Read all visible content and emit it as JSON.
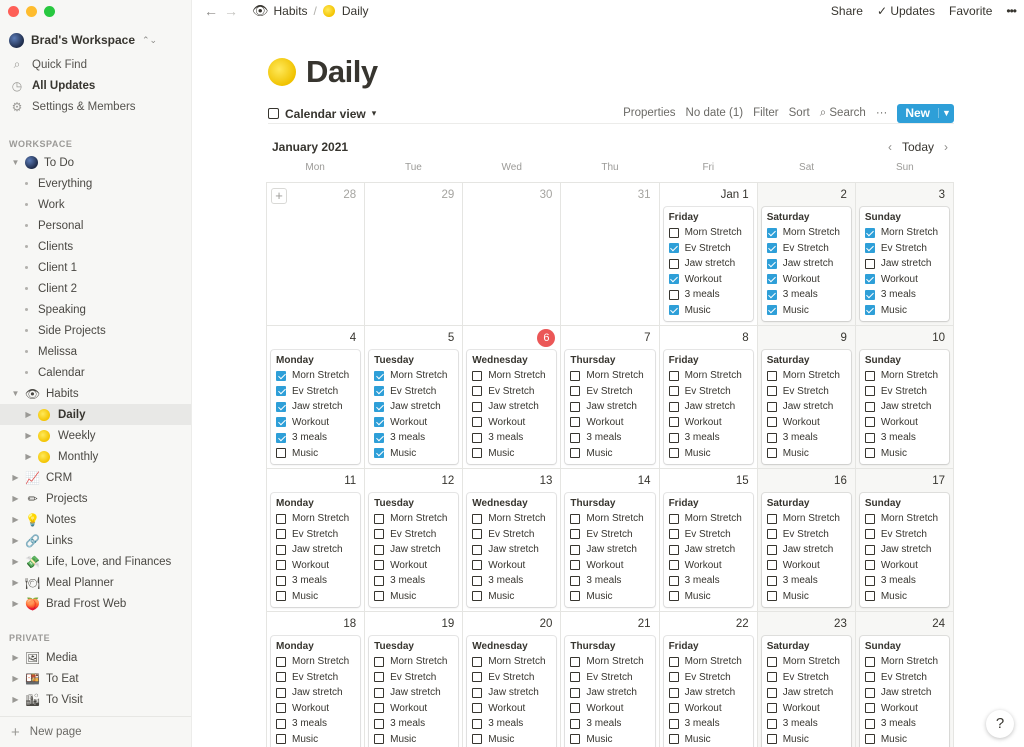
{
  "sidebar": {
    "workspace": "Brad's Workspace",
    "top_items": [
      {
        "label": "Quick Find",
        "icon": "search-icon"
      },
      {
        "label": "All Updates",
        "icon": "clock-icon",
        "bold": true
      },
      {
        "label": "Settings & Members",
        "icon": "gear-icon"
      }
    ],
    "workspace_label": "WORKSPACE",
    "private_label": "PRIVATE",
    "tree": [
      {
        "label": "To Do",
        "level": 0,
        "kind": "globe",
        "expanded": true
      },
      {
        "label": "Everything",
        "level": 1,
        "kind": "bullet"
      },
      {
        "label": "Work",
        "level": 1,
        "kind": "bullet"
      },
      {
        "label": "Personal",
        "level": 1,
        "kind": "bullet"
      },
      {
        "label": "Clients",
        "level": 1,
        "kind": "bullet"
      },
      {
        "label": "Client 1",
        "level": 1,
        "kind": "bullet"
      },
      {
        "label": "Client 2",
        "level": 1,
        "kind": "bullet"
      },
      {
        "label": "Speaking",
        "level": 1,
        "kind": "bullet"
      },
      {
        "label": "Side Projects",
        "level": 1,
        "kind": "bullet"
      },
      {
        "label": "Melissa",
        "level": 1,
        "kind": "bullet"
      },
      {
        "label": "Calendar",
        "level": 1,
        "kind": "bullet"
      },
      {
        "label": "Habits",
        "level": 0,
        "kind": "eye",
        "expanded": true
      },
      {
        "label": "Daily",
        "level": 1,
        "kind": "sun",
        "active": true
      },
      {
        "label": "Weekly",
        "level": 1,
        "kind": "sun"
      },
      {
        "label": "Monthly",
        "level": 1,
        "kind": "sun"
      },
      {
        "label": "CRM",
        "level": 0,
        "kind": "chart"
      },
      {
        "label": "Projects",
        "level": 0,
        "kind": "pencil"
      },
      {
        "label": "Notes",
        "level": 0,
        "kind": "bulb"
      },
      {
        "label": "Links",
        "level": 0,
        "kind": "link"
      },
      {
        "label": "Life, Love, and Finances",
        "level": 0,
        "kind": "money"
      },
      {
        "label": "Meal Planner",
        "level": 0,
        "kind": "dish"
      },
      {
        "label": "Brad Frost Web",
        "level": 0,
        "kind": "peach"
      }
    ],
    "private_tree": [
      {
        "label": "Media",
        "kind": "frame"
      },
      {
        "label": "To Eat",
        "kind": "food"
      },
      {
        "label": "To Visit",
        "kind": "city"
      }
    ],
    "new_page": "New page"
  },
  "topbar": {
    "crumb1": "Habits",
    "crumb2": "Daily",
    "share": "Share",
    "updates": "Updates",
    "favorite": "Favorite",
    "more": "•••"
  },
  "page": {
    "title": "Daily",
    "view": "Calendar view",
    "actions": [
      "Properties",
      "No date (1)",
      "Filter",
      "Sort",
      "Search"
    ],
    "new": "New",
    "month": "January 2021",
    "today": "Today"
  },
  "weekdays": [
    "Mon",
    "Tue",
    "Wed",
    "Thu",
    "Fri",
    "Sat",
    "Sun"
  ],
  "habits": [
    "Morn Stretch",
    "Ev Stretch",
    "Jaw stretch",
    "Workout",
    "3 meals",
    "Music"
  ],
  "habits_alt": [
    "Morn Stretch",
    "Ev Stretch",
    "Jaw stretch",
    "Workout",
    "3 meals",
    "Music"
  ],
  "days": [
    {
      "num": "28",
      "muted": true
    },
    {
      "num": "29",
      "muted": true
    },
    {
      "num": "30",
      "muted": true
    },
    {
      "num": "31",
      "muted": true
    },
    {
      "num": "Jan 1",
      "card": "Friday",
      "checks": [
        0,
        1,
        0,
        1,
        0,
        1
      ]
    },
    {
      "num": "2",
      "card": "Saturday",
      "checks": [
        1,
        1,
        1,
        1,
        1,
        1
      ]
    },
    {
      "num": "3",
      "card": "Sunday",
      "checks": [
        1,
        1,
        0,
        1,
        1,
        1
      ]
    },
    {
      "num": "4",
      "card": "Monday",
      "checks": [
        1,
        1,
        1,
        1,
        1,
        0
      ]
    },
    {
      "num": "5",
      "card": "Tuesday",
      "checks": [
        1,
        1,
        1,
        1,
        1,
        1
      ]
    },
    {
      "num": "6",
      "card": "Wednesday",
      "today": true,
      "checks": [
        0,
        0,
        0,
        0,
        0,
        0
      ]
    },
    {
      "num": "7",
      "card": "Thursday",
      "checks": [
        0,
        0,
        0,
        0,
        0,
        0
      ]
    },
    {
      "num": "8",
      "card": "Friday",
      "checks": [
        0,
        0,
        0,
        0,
        0,
        0
      ]
    },
    {
      "num": "9",
      "card": "Saturday",
      "checks": [
        0,
        0,
        0,
        0,
        0,
        0
      ]
    },
    {
      "num": "10",
      "card": "Sunday",
      "checks": [
        0,
        0,
        0,
        0,
        0,
        0
      ]
    },
    {
      "num": "11",
      "card": "Monday",
      "checks": [
        0,
        0,
        0,
        0,
        0,
        0
      ]
    },
    {
      "num": "12",
      "card": "Tuesday",
      "checks": [
        0,
        0,
        0,
        0,
        0,
        0
      ]
    },
    {
      "num": "13",
      "card": "Wednesday",
      "checks": [
        0,
        0,
        0,
        0,
        0,
        0
      ]
    },
    {
      "num": "14",
      "card": "Thursday",
      "checks": [
        0,
        0,
        0,
        0,
        0,
        0
      ]
    },
    {
      "num": "15",
      "card": "Friday",
      "checks": [
        0,
        0,
        0,
        0,
        0,
        0
      ]
    },
    {
      "num": "16",
      "card": "Saturday",
      "checks": [
        0,
        0,
        0,
        0,
        0,
        0
      ]
    },
    {
      "num": "17",
      "card": "Sunday",
      "checks": [
        0,
        0,
        0,
        0,
        0,
        0
      ]
    },
    {
      "num": "18",
      "card": "Monday",
      "checks": [
        0,
        0,
        0,
        0,
        0,
        0
      ]
    },
    {
      "num": "19",
      "card": "Tuesday",
      "checks": [
        0,
        0,
        0,
        0,
        0,
        0
      ]
    },
    {
      "num": "20",
      "card": "Wednesday",
      "checks": [
        0,
        0,
        0,
        0,
        0,
        0
      ]
    },
    {
      "num": "21",
      "card": "Thursday",
      "checks": [
        0,
        0,
        0,
        0,
        0,
        0
      ]
    },
    {
      "num": "22",
      "card": "Friday",
      "checks": [
        0,
        0,
        0,
        0,
        0,
        0
      ]
    },
    {
      "num": "23",
      "card": "Saturday",
      "checks": [
        0,
        0,
        0,
        0,
        0,
        0
      ]
    },
    {
      "num": "24",
      "card": "Sunday",
      "checks": [
        0,
        0,
        0,
        0,
        0,
        0
      ]
    }
  ],
  "colors": {
    "accent": "#2e9fd8",
    "today": "#eb5757"
  }
}
